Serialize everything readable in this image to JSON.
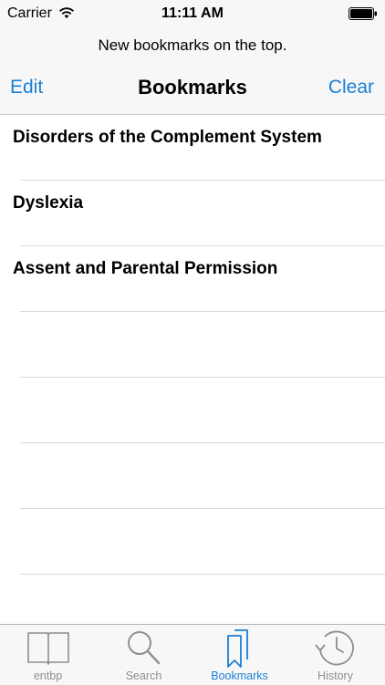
{
  "status_bar": {
    "carrier": "Carrier",
    "time": "11:11 AM"
  },
  "header": {
    "prompt": "New bookmarks on the top.",
    "edit_label": "Edit",
    "title": "Bookmarks",
    "clear_label": "Clear"
  },
  "bookmarks": [
    "Disorders of the Complement System",
    "Dyslexia",
    "Assent and Parental Permission"
  ],
  "tabs": [
    {
      "label": "entbp",
      "icon": "book-icon",
      "active": false
    },
    {
      "label": "Search",
      "icon": "magnifier-icon",
      "active": false
    },
    {
      "label": "Bookmarks",
      "icon": "bookmarks-icon",
      "active": true
    },
    {
      "label": "History",
      "icon": "clock-icon",
      "active": false
    }
  ],
  "colors": {
    "accent": "#1a7fd6",
    "inactive": "#8e8e93",
    "bar_bg": "#f7f7f7"
  }
}
